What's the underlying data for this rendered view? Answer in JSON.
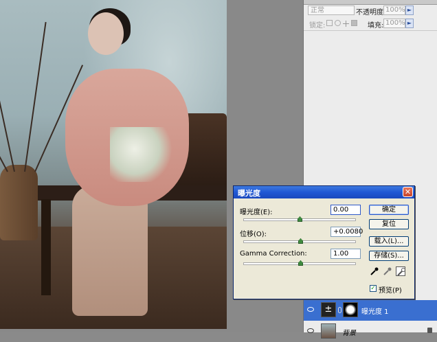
{
  "layers_panel": {
    "blend_mode": "正常",
    "opacity_label": "不透明度:",
    "opacity_value": "100%",
    "lock_label": "锁定:",
    "fill_label": "填充:",
    "fill_value": "100%",
    "layers": [
      {
        "name": "曝光度 1",
        "type": "adjustment",
        "selected": true
      },
      {
        "name": "背景",
        "type": "background",
        "selected": false
      }
    ]
  },
  "dialog": {
    "title": "曝光度",
    "exposure_label": "曝光度(E):",
    "exposure_value": "0.00",
    "offset_label": "位移(O):",
    "offset_value": "+0.0080",
    "gamma_label": "Gamma Correction:",
    "gamma_value": "1.00",
    "ok_label": "确定",
    "reset_label": "复位",
    "load_label": "载入(L)...",
    "save_label": "存储(S)...",
    "preview_label": "预览(P)",
    "preview_checked": true,
    "close_glyph": "✕",
    "check_glyph": "✓"
  },
  "icons": {
    "panel_arrow": "►",
    "adjustment_glyph": "±"
  },
  "colors": {
    "selection": "#3a6fd0",
    "titlebar": "#2057d4"
  }
}
